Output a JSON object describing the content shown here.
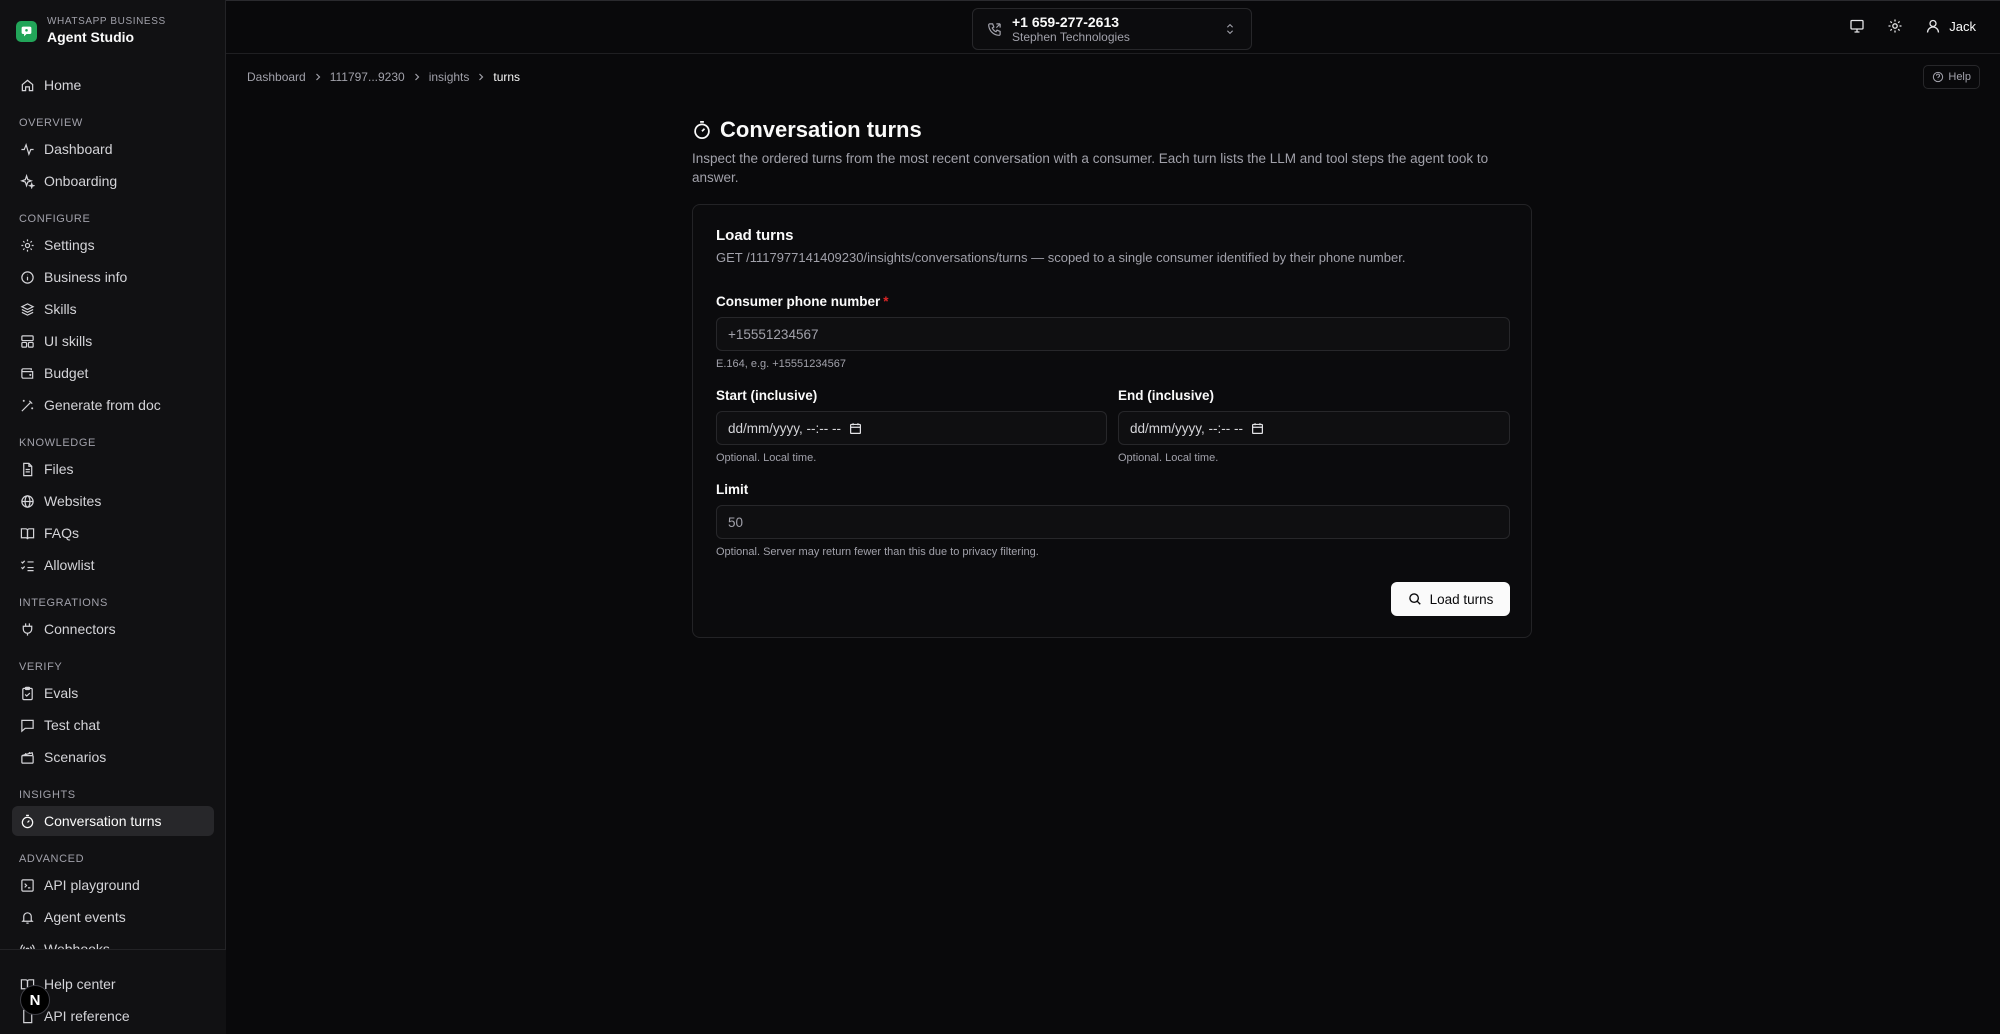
{
  "brand": {
    "subtitle": "WHATSAPP BUSINESS",
    "title": "Agent Studio"
  },
  "nav": {
    "home": "Home",
    "overview": {
      "label": "OVERVIEW",
      "items": [
        "Dashboard",
        "Onboarding"
      ]
    },
    "configure": {
      "label": "CONFIGURE",
      "items": [
        "Settings",
        "Business info",
        "Skills",
        "UI skills",
        "Budget",
        "Generate from doc"
      ]
    },
    "knowledge": {
      "label": "KNOWLEDGE",
      "items": [
        "Files",
        "Websites",
        "FAQs",
        "Allowlist"
      ]
    },
    "integrations": {
      "label": "INTEGRATIONS",
      "items": [
        "Connectors"
      ]
    },
    "verify": {
      "label": "VERIFY",
      "items": [
        "Evals",
        "Test chat",
        "Scenarios"
      ]
    },
    "insights": {
      "label": "INSIGHTS",
      "items": [
        "Conversation turns"
      ]
    },
    "advanced": {
      "label": "ADVANCED",
      "items": [
        "API playground",
        "Agent events",
        "Webhooks"
      ]
    },
    "footer": [
      "Help center",
      "API reference"
    ],
    "badge": "N"
  },
  "topbar": {
    "phone_number": "+1 659-277-2613",
    "org_name": "Stephen Technologies",
    "user_name": "Jack"
  },
  "breadcrumb": [
    "Dashboard",
    "111797...9230",
    "insights",
    "turns"
  ],
  "help_label": "Help",
  "page": {
    "title": "Conversation turns",
    "description": "Inspect the ordered turns from the most recent conversation with a consumer. Each turn lists the LLM and tool steps the agent took to answer."
  },
  "card": {
    "title": "Load turns",
    "description": "GET /1117977141409230/insights/conversations/turns — scoped to a single consumer identified by their phone number.",
    "phone": {
      "label": "Consumer phone number",
      "required": "*",
      "placeholder": "+15551234567",
      "help": "E.164, e.g. +15551234567"
    },
    "start": {
      "label": "Start (inclusive)",
      "value": "dd/mm/yyyy, --:-- --",
      "help": "Optional. Local time."
    },
    "end": {
      "label": "End (inclusive)",
      "value": "dd/mm/yyyy, --:-- --",
      "help": "Optional. Local time."
    },
    "limit": {
      "label": "Limit",
      "placeholder": "50",
      "help": "Optional. Server may return fewer than this due to privacy filtering."
    },
    "submit_label": "Load turns"
  }
}
